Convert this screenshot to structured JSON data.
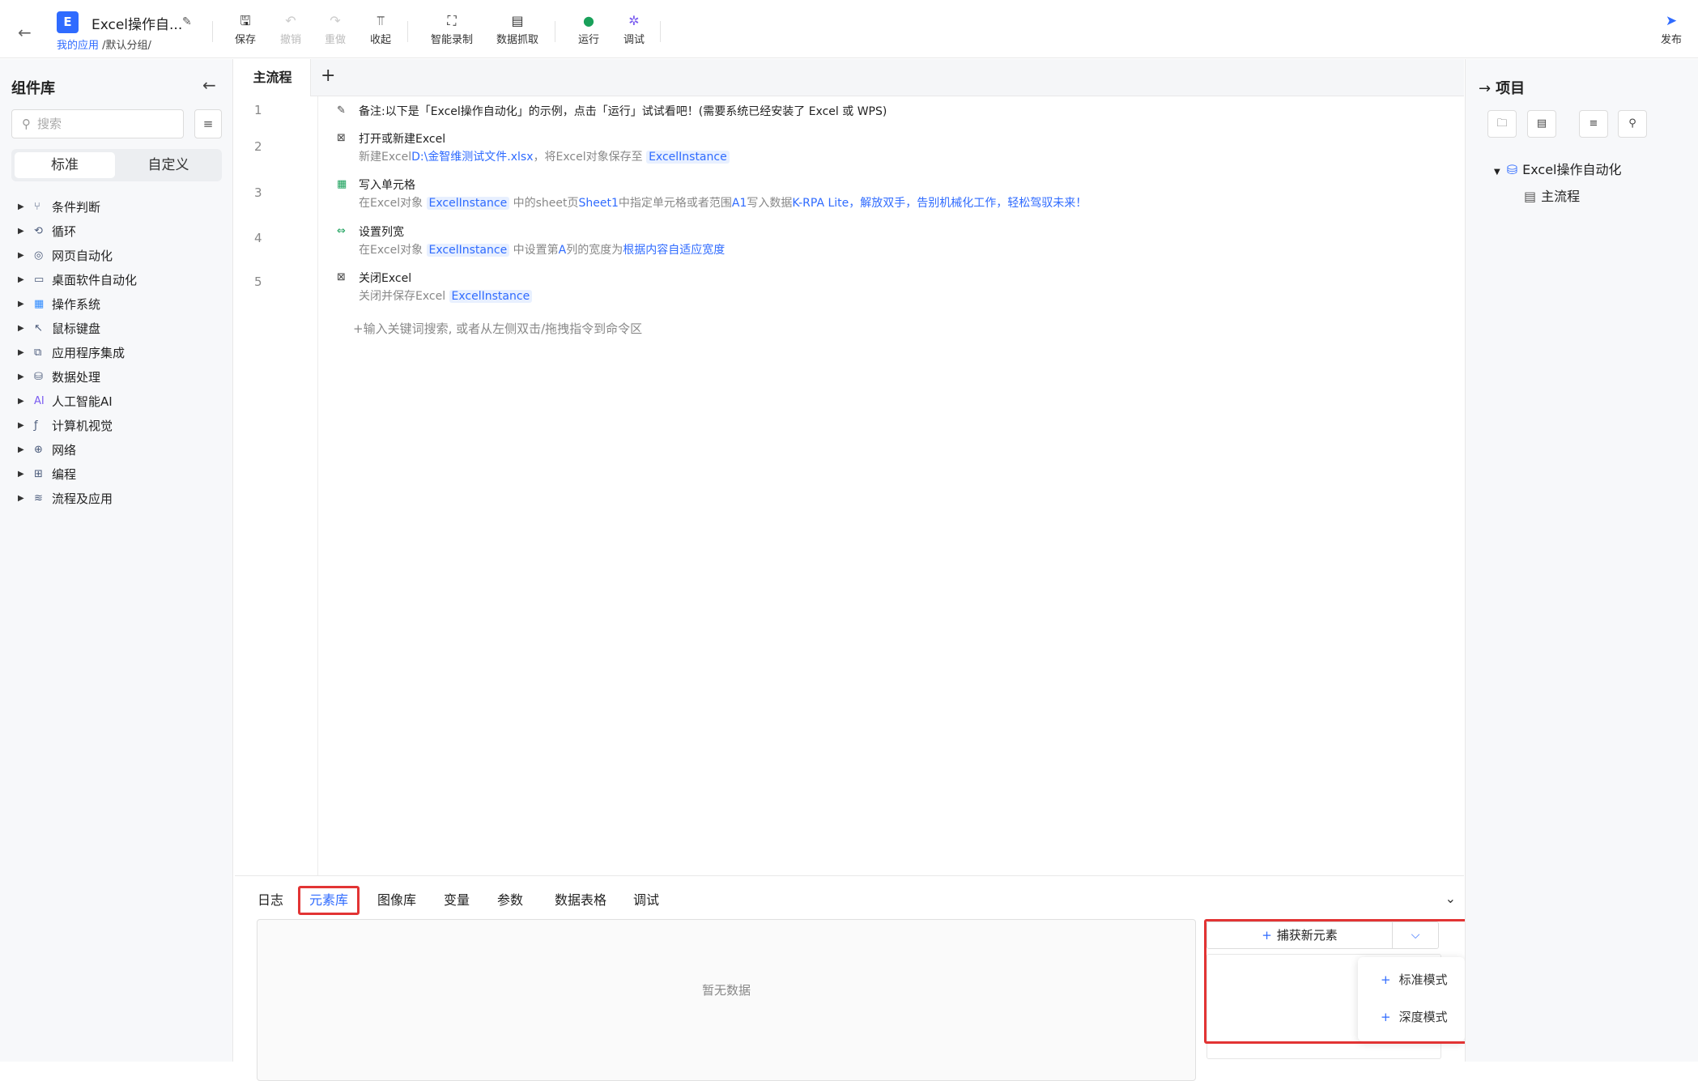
{
  "header": {
    "app_initial": "E",
    "app_title": "Excel操作自...",
    "crumb_link": "我的应用",
    "crumb_rest": "/默认分组/",
    "toolbar": {
      "save": "保存",
      "undo": "撤销",
      "redo": "重做",
      "collapse": "收起",
      "smart_record": "智能录制",
      "data_grab": "数据抓取",
      "run": "运行",
      "debug": "调试"
    },
    "publish": "发布"
  },
  "sidebar": {
    "title": "组件库",
    "search_placeholder": "搜索",
    "tab_standard": "标准",
    "tab_custom": "自定义",
    "categories": [
      "条件判断",
      "循环",
      "网页自动化",
      "桌面软件自动化",
      "操作系统",
      "鼠标键盘",
      "应用程序集成",
      "数据处理",
      "人工智能AI",
      "计算机视觉",
      "网络",
      "编程",
      "流程及应用"
    ]
  },
  "editor": {
    "tab": "主流程",
    "add_tab": "+",
    "line_numbers": [
      "1",
      "2",
      "3",
      "4",
      "5"
    ],
    "steps": [
      {
        "note": "备注:以下是「Excel操作自动化」的示例，点击「运行」试试看吧！(需要系统已经安装了 Excel 或 WPS)"
      },
      {
        "title": "打开或新建Excel",
        "d1": "新建Excel",
        "d2": "D:\\金智维测试文件.xlsx",
        "d3": "，将Excel对象保存至",
        "var": "ExcelInstance"
      },
      {
        "title": "写入单元格",
        "d1": "在Excel对象",
        "var": "ExcelInstance",
        "d2": "中的sheet页",
        "d3": "Sheet1",
        "d4": "中指定单元格或者范围",
        "d5": "A1",
        "d6": "写入数据",
        "d7": "K-RPA Lite，解放双手，告别机械化工作，轻松驾驭未来！"
      },
      {
        "title": "设置列宽",
        "d1": "在Excel对象",
        "var": "ExcelInstance",
        "d2": "中设置第",
        "d3": "A",
        "d4": "列的宽度为",
        "d5": "根据内容自适应宽度"
      },
      {
        "title": "关闭Excel",
        "d1": "关闭并保存Excel",
        "var": "ExcelInstance"
      }
    ],
    "hint": "+输入关键词搜索, 或者从左侧双击/拖拽指令到命令区"
  },
  "bottom": {
    "tabs": [
      "日志",
      "元素库",
      "图像库",
      "变量",
      "参数",
      "数据表格",
      "调试"
    ],
    "active_tab": "元素库",
    "empty": "暂无数据",
    "capture": "捕获新元素",
    "menu": [
      "标准模式",
      "深度模式"
    ]
  },
  "project": {
    "title": "项目",
    "root": "Excel操作自动化",
    "child": "主流程"
  }
}
